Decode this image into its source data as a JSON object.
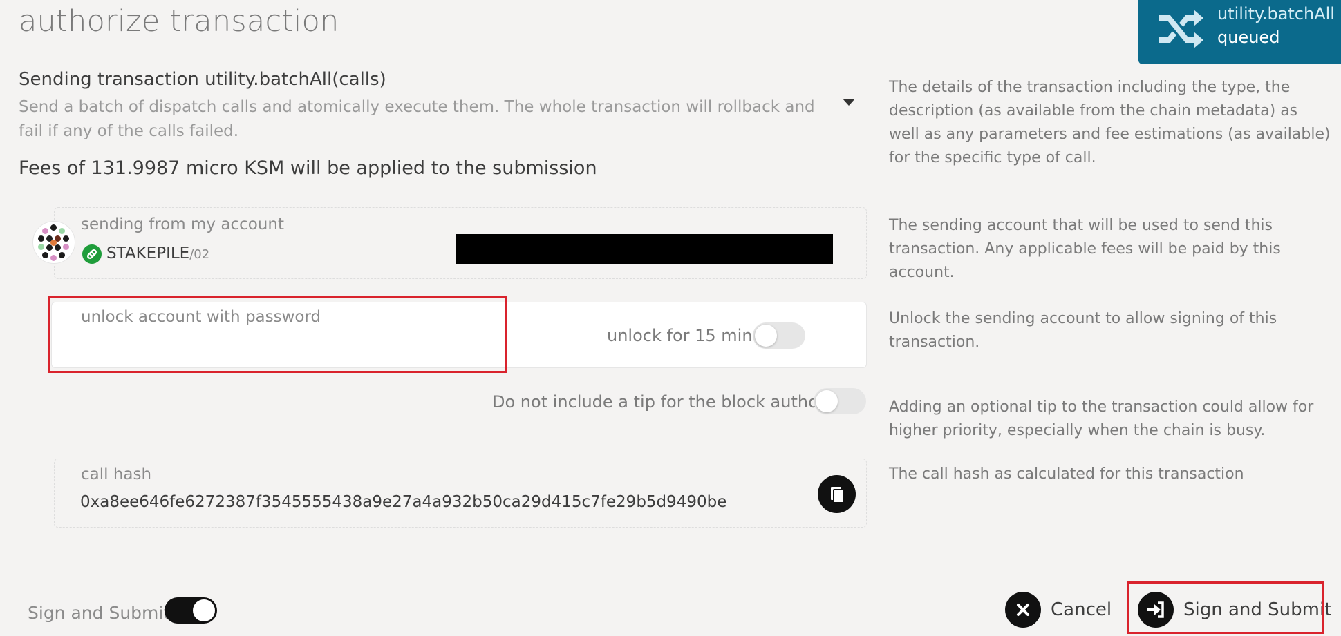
{
  "page": {
    "title": "authorize transaction"
  },
  "queue": {
    "method": "utility.batchAll",
    "status": "queued",
    "icon": "shuffle-icon"
  },
  "transaction": {
    "title": "Sending transaction utility.batchAll(calls)",
    "description": "Send a batch of dispatch calls and atomically execute them. The whole transaction will rollback and fail if any of the calls failed.",
    "fees": "Fees of 131.9987 micro KSM will be applied to the submission",
    "help": "The details of the transaction including the type, the description (as available from the chain metadata) as well as any parameters and fee estimations (as available) for the specific type of call."
  },
  "account": {
    "label": "sending from my account",
    "name": "STAKEPILE",
    "suffix": "/02",
    "help": "The sending account that will be used to send this transaction. Any applicable fees will be paid by this account."
  },
  "unlock": {
    "label": "unlock account with password",
    "value": "",
    "toggle_label": "unlock for 15 min",
    "toggle_on": false,
    "help": "Unlock the sending account to allow signing of this transaction."
  },
  "tip": {
    "label": "Do not include a tip for the block author",
    "toggle_on": false,
    "help": "Adding an optional tip to the transaction could allow for higher priority, especially when the chain is busy."
  },
  "hash": {
    "label": "call hash",
    "value": "0xa8ee646fe6272387f3545555438a9e27a4a932b50ca29d415c7fe29b5d9490be",
    "help": "The call hash as calculated for this transaction"
  },
  "footer": {
    "sign_toggle_label": "Sign and Submit",
    "sign_toggle_on": true,
    "cancel_label": "Cancel",
    "submit_label": "Sign and Submit"
  },
  "colors": {
    "badge": "#0b6a8c",
    "highlight": "#d9232d",
    "chain": "#1f9d3b"
  }
}
